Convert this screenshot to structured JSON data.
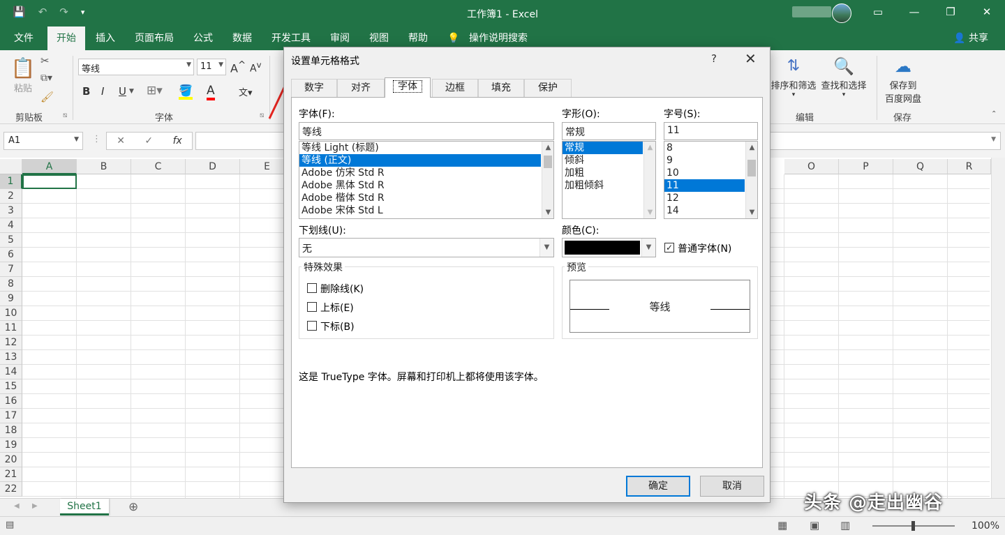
{
  "window": {
    "title": "工作簿1  -  Excel",
    "qat": [
      "💾",
      "↶",
      "↷",
      "▾"
    ],
    "controls": [
      "▭",
      "—",
      "❐",
      "✕"
    ]
  },
  "menu": {
    "tabs": [
      "文件",
      "开始",
      "插入",
      "页面布局",
      "公式",
      "数据",
      "开发工具",
      "审阅",
      "视图",
      "帮助"
    ],
    "active": "开始",
    "search": "操作说明搜索",
    "share": "共享"
  },
  "ribbon": {
    "paste": "粘贴",
    "clipboard_label": "剪贴板",
    "font_name": "等线",
    "font_size": "11",
    "font_label": "字体",
    "bold": "B",
    "italic": "I",
    "underline": "U",
    "sort_filter": "排序和筛选",
    "find_select": "查找和选择",
    "edit_label": "编辑",
    "save_to": "保存到",
    "baidu_pan": "百度网盘",
    "save_label": "保存"
  },
  "formula_bar": {
    "name_box": "A1",
    "fx": "fx",
    "cancel": "✕",
    "confirm": "✓"
  },
  "grid": {
    "col_headers_left": [
      "A",
      "B",
      "C",
      "D",
      "E"
    ],
    "col_headers_right": [
      "O",
      "P",
      "Q",
      "R"
    ],
    "rows": [
      "1",
      "2",
      "3",
      "4",
      "5",
      "6",
      "7",
      "8",
      "9",
      "10",
      "11",
      "12",
      "13",
      "14",
      "15",
      "16",
      "17",
      "18",
      "19",
      "20",
      "21",
      "22"
    ]
  },
  "sheets": {
    "tab": "Sheet1",
    "add": "⊕"
  },
  "status": {
    "zoom": "100%"
  },
  "watermark": "头条 @走出幽谷",
  "dialog": {
    "title": "设置单元格格式",
    "help": "?",
    "close": "✕",
    "tabs": [
      "数字",
      "对齐",
      "字体",
      "边框",
      "填充",
      "保护"
    ],
    "active_tab": "字体",
    "font_label": "字体(F):",
    "font_value": "等线",
    "font_list": [
      "等线 Light (标题)",
      "等线 (正文)",
      "Adobe 仿宋 Std R",
      "Adobe 黑体 Std R",
      "Adobe 楷体 Std R",
      "Adobe 宋体 Std L"
    ],
    "font_selected_index": 1,
    "style_label": "字形(O):",
    "style_value": "常规",
    "style_list": [
      "常规",
      "倾斜",
      "加粗",
      "加粗倾斜"
    ],
    "style_selected_index": 0,
    "size_label": "字号(S):",
    "size_value": "11",
    "size_list": [
      "8",
      "9",
      "10",
      "11",
      "12",
      "14"
    ],
    "size_selected_index": 3,
    "underline_label": "下划线(U):",
    "underline_value": "无",
    "color_label": "颜色(C):",
    "color_value": "#000000",
    "normal_font_label": "普通字体(N)",
    "normal_font_checked": true,
    "effects_label": "特殊效果",
    "strikethrough": "删除线(K)",
    "superscript": "上标(E)",
    "subscript": "下标(B)",
    "preview_label": "预览",
    "preview_text": "等线",
    "info": "这是 TrueType 字体。屏幕和打印机上都将使用该字体。",
    "ok": "确定",
    "cancel": "取消"
  }
}
